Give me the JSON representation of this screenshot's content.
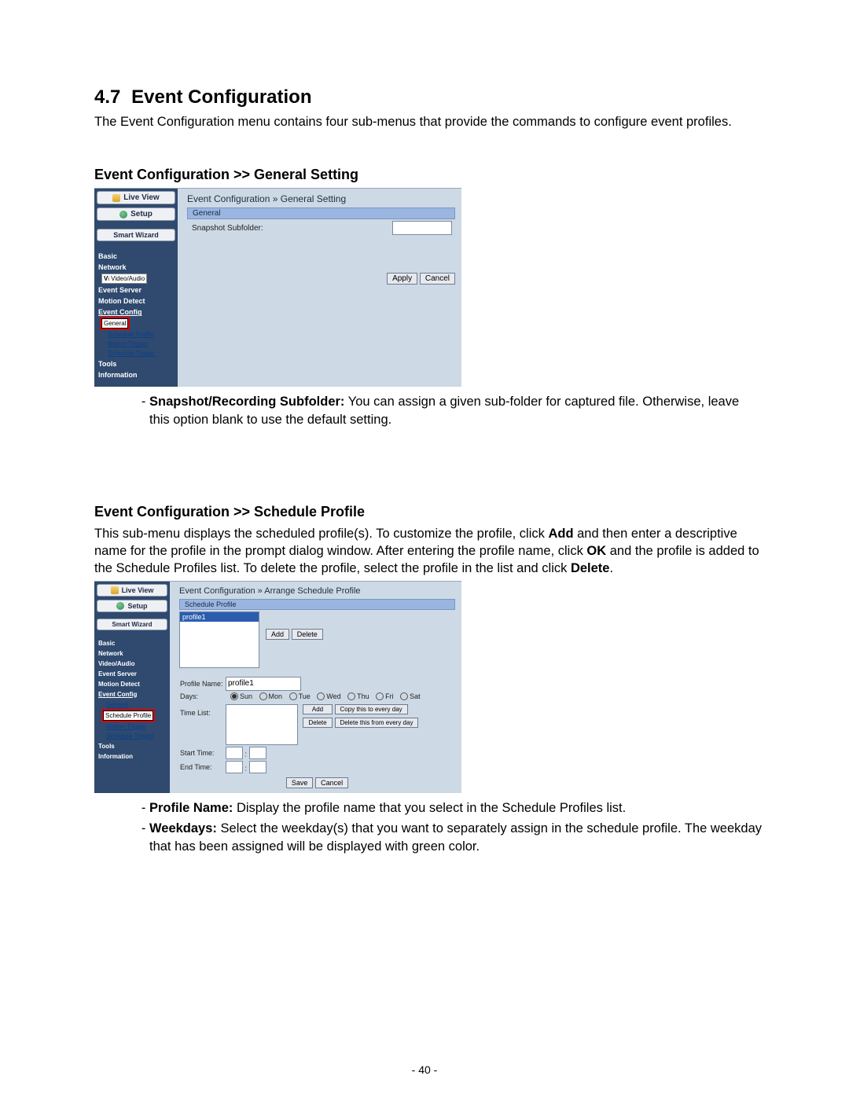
{
  "section": {
    "number": "4.7",
    "title": "Event Configuration"
  },
  "intro": "The Event Configuration menu contains four sub-menus that provide the commands to configure event profiles.",
  "sub1": {
    "heading": "Event Configuration >> General Setting",
    "sidebar": {
      "live": "Live View",
      "setup": "Setup",
      "wizard": "Smart Wizard",
      "items": [
        "Basic",
        "Network"
      ],
      "va": "Video/Audio",
      "items2": [
        "Event Server",
        "Motion Detect"
      ],
      "ec": "Event Config",
      "sub": [
        "General",
        "Schedule Profile",
        "Motion Trigger",
        "Schedule Trigger"
      ],
      "items3": [
        "Tools",
        "Information"
      ]
    },
    "content": {
      "breadcrumb": "Event Configuration » General Setting",
      "panel_title": "General",
      "subfolder_label": "Snapshot Subfolder:",
      "apply": "Apply",
      "cancel": "Cancel"
    },
    "bullet_label": "Snapshot/Recording Subfolder:",
    "bullet_text": " You can assign a given sub-folder for captured file. Otherwise, leave this option blank to use the default setting."
  },
  "sub2": {
    "heading": "Event Configuration >> Schedule Profile",
    "para_parts": [
      "This sub-menu displays the scheduled profile(s). To customize the profile, click ",
      "Add",
      " and then enter a descriptive name for the profile in the prompt dialog window. After entering the profile name, click ",
      "OK",
      " and the profile is added to the Schedule Profiles list. To delete the profile, select the profile in the list and click ",
      "Delete",
      "."
    ],
    "sidebar": {
      "live": "Live View",
      "setup": "Setup",
      "wizard": "Smart Wizard",
      "items": [
        "Basic",
        "Network",
        "Video/Audio",
        "Event Server",
        "Motion Detect"
      ],
      "ec": "Event Config",
      "sub": [
        "General",
        "Schedule Profile",
        "Motion Trigger",
        "Schedule Trigger"
      ],
      "items3": [
        "Tools",
        "Information"
      ]
    },
    "content": {
      "breadcrumb": "Event Configuration » Arrange Schedule Profile",
      "panel_title": "Schedule Profile",
      "profile_row": "profile1",
      "add": "Add",
      "delete": "Delete",
      "pn_label": "Profile Name:",
      "pn_value": "profile1",
      "days_label": "Days:",
      "days": [
        "Sun",
        "Mon",
        "Tue",
        "Wed",
        "Thu",
        "Fri",
        "Sat"
      ],
      "tl_label": "Time List:",
      "tl_add": "Add",
      "tl_copy": "Copy this to every day",
      "tl_delete": "Delete",
      "tl_delfrom": "Delete this from every day",
      "st_label": "Start Time:",
      "et_label": "End Time:",
      "save": "Save",
      "cancel": "Cancel"
    },
    "bullets": [
      {
        "label": "Profile Name:",
        "text": " Display the profile name that you select in the Schedule Profiles list."
      },
      {
        "label": "Weekdays:",
        "text": " Select the weekday(s) that you want to separately assign in the schedule profile. The weekday that has been assigned will be displayed with green color."
      }
    ]
  },
  "footer": "- 40 -"
}
